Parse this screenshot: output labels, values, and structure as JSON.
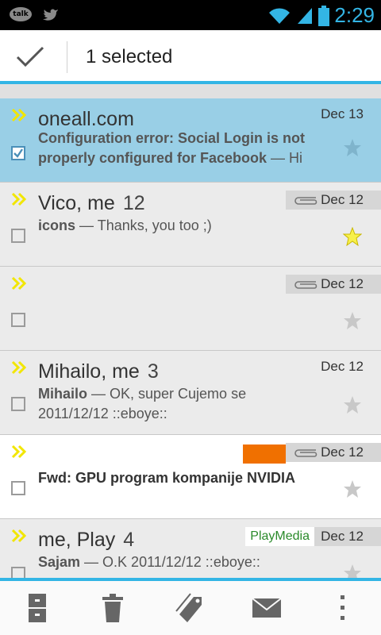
{
  "status_bar": {
    "talk_label": "talk",
    "time": "2:29"
  },
  "action_bar": {
    "title": "1 selected"
  },
  "conversations": [
    {
      "sender": "oneall.com",
      "count": "",
      "date": "Dec 13",
      "subject_bold": "Configuration error: Social Login is not properly configured for Facebook",
      "snippet": " — Hi",
      "selected": true,
      "starred": false
    },
    {
      "sender": "Vico, me",
      "count": "12",
      "date": "Dec 12",
      "subject_bold": "icons",
      "snippet": " — Thanks, you too ;)",
      "has_attachment": true,
      "starred": true
    },
    {
      "sender": "",
      "count": "",
      "date": "Dec 12",
      "subject_bold": "",
      "snippet": "",
      "has_attachment": true,
      "starred": false
    },
    {
      "sender": "Mihailo, me",
      "count": "3",
      "date": "Dec 12",
      "subject_bold": "Mihailo",
      "snippet": " — OK, super Cujemo se 2011/12/12 ::eboye::",
      "starred": false
    },
    {
      "sender": "",
      "count": "",
      "date": "Dec 12",
      "subject_bold": "Fwd: GPU program kompanije NVIDIA",
      "snippet": "",
      "has_attachment": true,
      "label_color": "#f07000",
      "starred": false
    },
    {
      "sender": "me, Play",
      "count": "4",
      "date": "Dec 12",
      "label": "PlayMedia",
      "subject_bold": "Sajam",
      "snippet": " — O.K 2011/12/12 ::eboye::",
      "starred": false
    }
  ],
  "colors": {
    "accent": "#33b5e5",
    "selected_bg": "#99cfe6",
    "importance": "#f2e600"
  },
  "icons": {
    "archive": "archive-icon",
    "delete": "trash-icon",
    "labels": "label-icon",
    "mark_unread": "envelope-icon",
    "overflow": "overflow-menu-icon"
  }
}
